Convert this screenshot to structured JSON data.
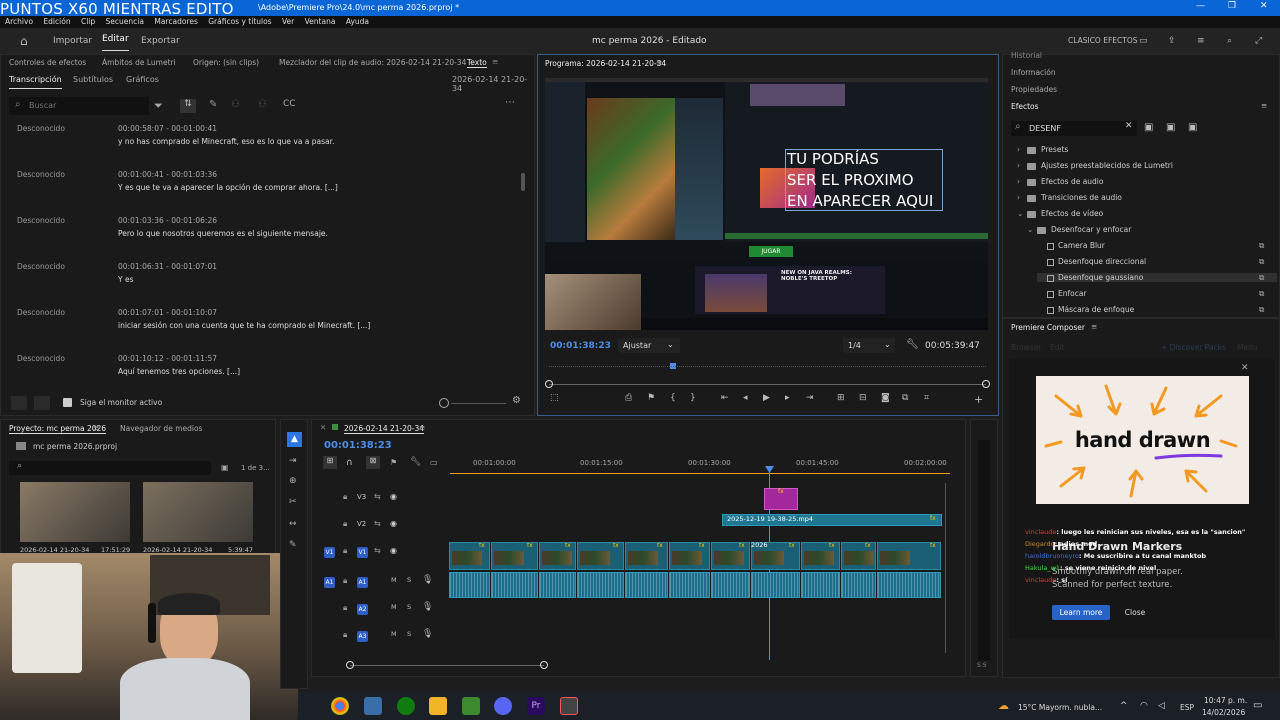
{
  "overlay": {
    "text": "PUNTOS X60 MIENTRAS EDITO"
  },
  "window": {
    "path": "\\Adobe\\Premiere Pro\\24.0\\mc perma 2026.prproj *",
    "minimize": "—",
    "restore": "❐",
    "close": "✕"
  },
  "menu": [
    "Archivo",
    "Edición",
    "Clip",
    "Secuencia",
    "Marcadores",
    "Gráficos y títulos",
    "Ver",
    "Ventana",
    "Ayuda"
  ],
  "workspace": {
    "importar": "Importar",
    "editar": "Editar",
    "exportar": "Exportar",
    "program_title": "mc perma 2026 - Editado",
    "clasicos": "CLASICO EFECTOS"
  },
  "source_panel": {
    "tabs": [
      "Controles de efectos",
      "Ámbitos de Lumetri",
      "Origen: (sin clips)",
      "Mezclador del clip de audio: 2026-02-14 21-20-34",
      "Texto"
    ],
    "subtabs": [
      "Transcripción",
      "Subtítulos",
      "Gráficos"
    ],
    "sequence_name": "2026-02-14 21-20-34",
    "search_placeholder": "Buscar",
    "follow_monitor": "Siga el monitor activo",
    "rows": [
      {
        "speaker": "Desconocido",
        "tc": "00:00:58:07 - 00:01:00:41",
        "text": "y no has comprado el Minecraft, eso es lo que va a pasar."
      },
      {
        "speaker": "Desconocido",
        "tc": "00:01:00:41 - 00:01:03:36",
        "text": "Y es que te va a aparecer la opción de comprar ahora. [...]"
      },
      {
        "speaker": "Desconocido",
        "tc": "00:01:03:36 - 00:01:06:26",
        "text": "Pero lo que nosotros queremos es el siguiente mensaje."
      },
      {
        "speaker": "Desconocido",
        "tc": "00:01:06:31 - 00:01:07:01",
        "text": "Y es"
      },
      {
        "speaker": "Desconocido",
        "tc": "00:01:07:01 - 00:01:10:07",
        "text": "iniciar sesión con una cuenta que te ha comprado el Minecraft. [...]"
      },
      {
        "speaker": "Desconocido",
        "tc": "00:01:10:12 - 00:01:11:57",
        "text": "Aquí tenemos tres opciones. [...]"
      }
    ]
  },
  "program": {
    "title": "Programa: 2026-02-14 21-20-34",
    "timecode": "00:01:38:23",
    "fit": "Ajustar",
    "quality": "1/4",
    "duration": "00:05:39:47",
    "overlay_text": [
      "TU PODRÍAS",
      "SER EL PROXIMO",
      "EN APARECER AQUI"
    ],
    "screen_title": "NEW ON JAVA REALMS: NOBLE'S TREETOP",
    "get_label": "JUGAR"
  },
  "effects_panel": {
    "tabs": [
      "Historial",
      "Información",
      "Propiedades",
      "Efectos"
    ],
    "search_value": "DESENF",
    "items": [
      {
        "label": "Presets",
        "type": "folder",
        "indent": 0
      },
      {
        "label": "Ajustes preestablecidos de Lumetri",
        "type": "folder",
        "indent": 0
      },
      {
        "label": "Efectos de audio",
        "type": "folder",
        "indent": 0
      },
      {
        "label": "Transiciones de audio",
        "type": "folder",
        "indent": 0
      },
      {
        "label": "Efectos de vídeo",
        "type": "folder",
        "indent": 0
      },
      {
        "label": "Desenfocar y enfocar",
        "type": "folder",
        "indent": 1
      },
      {
        "label": "Camera Blur",
        "type": "effect",
        "indent": 2
      },
      {
        "label": "Desenfoque direccional",
        "type": "effect",
        "indent": 2
      },
      {
        "label": "Desenfoque gaussiano",
        "type": "effect",
        "indent": 2
      },
      {
        "label": "Enfocar",
        "type": "effect",
        "indent": 2
      },
      {
        "label": "Máscara de enfoque",
        "type": "effect",
        "indent": 2
      }
    ]
  },
  "composer": {
    "title": "Premiere Composer",
    "tabs": [
      "Browser",
      "Edit"
    ],
    "discover": "+ Discover Packs",
    "menu": "Menu",
    "promo_title": "hand drawn",
    "promo_heading": "Hand Drawn Markers",
    "promo_body1": "Smoothly drawn on real paper.",
    "promo_body2": "Scanned for perfect texture.",
    "learn_more": "Learn more",
    "close": "Close"
  },
  "chat": [
    {
      "user": "vinclaude",
      "msg": ": luego les reinician sus niveles, esa es la \"sancion\""
    },
    {
      "user": "Diegardo",
      "msg": ": adios mod"
    },
    {
      "user": "haroldbruoneyro",
      "msg": ": Me suscribire a tu canal manktob"
    },
    {
      "user": "Hakula_w1",
      "msg": ": se viene reinicio de nivel"
    },
    {
      "user": "vinclaude",
      "msg": ": sí"
    }
  ],
  "project": {
    "tabs": [
      "Proyecto: mc perma 2026",
      "Navegador de medios"
    ],
    "file": "mc perma 2026.prproj",
    "count": "1 de 3...",
    "clips": [
      {
        "name": "2026-02-14 21-20-34",
        "dur": "17:51:29"
      },
      {
        "name": "2026-02-14 21-20-34",
        "dur": "5:39:47"
      }
    ]
  },
  "timeline": {
    "title": "2026-02-14 21-20-34",
    "timecode": "00:01:38:23",
    "ruler": [
      "00:01:00:00",
      "00:01:15:00",
      "00:01:30:00",
      "00:01:45:00",
      "00:02:00:00"
    ],
    "clip_v2": "2025-12-19 19-38-25.mp4",
    "clip_v1_label": "2026",
    "tracks": [
      "V3",
      "V2",
      "V1",
      "A1",
      "A2",
      "A3"
    ],
    "ms": [
      "M",
      "S"
    ]
  },
  "taskbar": {
    "weather": "15°C  Mayorm. nubla...",
    "lang": "ESP",
    "time": "10:47 p. m.",
    "date": "14/02/2026"
  },
  "colors": {
    "accent": "#2e76e6",
    "titlebar": "#0a66d6",
    "clip": "#1a5f73",
    "fx_pink": "#a3289b"
  }
}
